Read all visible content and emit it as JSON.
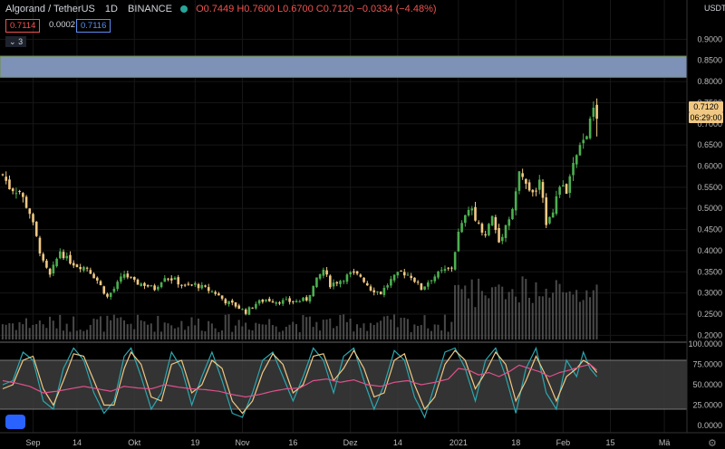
{
  "header": {
    "symbol": "Algorand / TetherUS",
    "interval": "1D",
    "exchange": "BINANCE",
    "ohlc": "O0.7449 H0.7600 L0.6700 C0.7120 −0.0334 (−4.48%)",
    "bid": "0.7114",
    "spread": "0.0002",
    "ask": "0.7116",
    "collapse_label": "3"
  },
  "price_axis": {
    "currency": "USDT",
    "current_price_label": "0.7120",
    "countdown_label": "06:29:00"
  },
  "colors": {
    "up": "#4caf50",
    "down": "#f0c883",
    "zone_fill": "#7e92b8",
    "k_line": "#2aa7b0",
    "d_line": "#f0c883",
    "rsi_line": "#e0508c",
    "band": "#3c3c3c"
  },
  "icons": [
    "chevron-down-icon",
    "tradingview-logo-icon",
    "settings-gear-icon"
  ],
  "chart_data": [
    {
      "type": "candlestick",
      "title": "Algorand / TetherUS 1D BINANCE",
      "ylim": [
        0.19,
        0.95
      ],
      "y_ticks": [
        0.2,
        0.25,
        0.3,
        0.35,
        0.4,
        0.45,
        0.5,
        0.55,
        0.6,
        0.65,
        0.7,
        0.75,
        0.8,
        0.85,
        0.9
      ],
      "x_tick_labels": [
        "Sep",
        "14",
        "Okt",
        "19",
        "Nov",
        "16",
        "Dez",
        "14",
        "2021",
        "18",
        "Feb",
        "15",
        "Mä"
      ],
      "x_tick_day_index": [
        9,
        22,
        39,
        57,
        71,
        86,
        103,
        117,
        135,
        152,
        166,
        180,
        196
      ],
      "resistance_zone": [
        0.81,
        0.86
      ],
      "price_anchors": [
        [
          0,
          0.58
        ],
        [
          2,
          0.55
        ],
        [
          5,
          0.54
        ],
        [
          8,
          0.49
        ],
        [
          12,
          0.37
        ],
        [
          14,
          0.34
        ],
        [
          17,
          0.4
        ],
        [
          19,
          0.38
        ],
        [
          22,
          0.365
        ],
        [
          25,
          0.36
        ],
        [
          28,
          0.33
        ],
        [
          31,
          0.29
        ],
        [
          33,
          0.31
        ],
        [
          36,
          0.345
        ],
        [
          39,
          0.325
        ],
        [
          42,
          0.32
        ],
        [
          45,
          0.31
        ],
        [
          48,
          0.34
        ],
        [
          51,
          0.33
        ],
        [
          54,
          0.315
        ],
        [
          57,
          0.32
        ],
        [
          60,
          0.31
        ],
        [
          63,
          0.3
        ],
        [
          66,
          0.28
        ],
        [
          69,
          0.27
        ],
        [
          72,
          0.255
        ],
        [
          75,
          0.275
        ],
        [
          78,
          0.285
        ],
        [
          81,
          0.28
        ],
        [
          84,
          0.28
        ],
        [
          87,
          0.28
        ],
        [
          90,
          0.285
        ],
        [
          93,
          0.33
        ],
        [
          95,
          0.355
        ],
        [
          97,
          0.32
        ],
        [
          100,
          0.33
        ],
        [
          103,
          0.345
        ],
        [
          106,
          0.34
        ],
        [
          109,
          0.31
        ],
        [
          112,
          0.3
        ],
        [
          115,
          0.33
        ],
        [
          118,
          0.35
        ],
        [
          121,
          0.34
        ],
        [
          124,
          0.31
        ],
        [
          127,
          0.335
        ],
        [
          130,
          0.35
        ],
        [
          133,
          0.36
        ],
        [
          135,
          0.44
        ],
        [
          137,
          0.48
        ],
        [
          139,
          0.5
        ],
        [
          141,
          0.46
        ],
        [
          143,
          0.44
        ],
        [
          145,
          0.48
        ],
        [
          147,
          0.42
        ],
        [
          149,
          0.46
        ],
        [
          151,
          0.5
        ],
        [
          153,
          0.58
        ],
        [
          155,
          0.56
        ],
        [
          157,
          0.53
        ],
        [
          159,
          0.56
        ],
        [
          161,
          0.47
        ],
        [
          163,
          0.5
        ],
        [
          165,
          0.55
        ],
        [
          167,
          0.54
        ],
        [
          169,
          0.6
        ],
        [
          171,
          0.64
        ],
        [
          172,
          0.66
        ],
        [
          174,
          0.7
        ],
        [
          175,
          0.7449
        ],
        [
          176,
          0.712
        ]
      ],
      "last_candle": {
        "open": 0.7449,
        "high": 0.76,
        "low": 0.67,
        "close": 0.712,
        "change": -0.0334,
        "change_pct": -4.48
      }
    },
    {
      "type": "line",
      "title": "",
      "ylim": [
        0,
        100
      ],
      "y_ticks": [
        0,
        25,
        50,
        75,
        100
      ],
      "y_tick_labels": [
        "0.0000",
        "25.0000",
        "50.0000",
        "75.0000",
        "100.0000"
      ],
      "band": [
        20,
        80
      ],
      "series": [
        {
          "key": "k",
          "anchors": [
            [
              0,
              50
            ],
            [
              3,
              55
            ],
            [
              6,
              90
            ],
            [
              9,
              80
            ],
            [
              12,
              30
            ],
            [
              15,
              20
            ],
            [
              18,
              70
            ],
            [
              21,
              95
            ],
            [
              24,
              80
            ],
            [
              27,
              40
            ],
            [
              30,
              15
            ],
            [
              33,
              30
            ],
            [
              36,
              85
            ],
            [
              38,
              95
            ],
            [
              41,
              60
            ],
            [
              44,
              20
            ],
            [
              47,
              40
            ],
            [
              50,
              90
            ],
            [
              53,
              70
            ],
            [
              56,
              25
            ],
            [
              59,
              60
            ],
            [
              62,
              90
            ],
            [
              65,
              55
            ],
            [
              68,
              15
            ],
            [
              71,
              10
            ],
            [
              74,
              40
            ],
            [
              77,
              80
            ],
            [
              80,
              90
            ],
            [
              83,
              60
            ],
            [
              86,
              30
            ],
            [
              89,
              60
            ],
            [
              92,
              95
            ],
            [
              95,
              80
            ],
            [
              98,
              40
            ],
            [
              101,
              85
            ],
            [
              104,
              95
            ],
            [
              107,
              55
            ],
            [
              110,
              20
            ],
            [
              113,
              50
            ],
            [
              116,
              92
            ],
            [
              119,
              80
            ],
            [
              122,
              35
            ],
            [
              125,
              10
            ],
            [
              128,
              50
            ],
            [
              131,
              90
            ],
            [
              134,
              95
            ],
            [
              137,
              70
            ],
            [
              140,
              30
            ],
            [
              143,
              80
            ],
            [
              146,
              95
            ],
            [
              149,
              60
            ],
            [
              152,
              15
            ],
            [
              155,
              70
            ],
            [
              158,
              95
            ],
            [
              161,
              40
            ],
            [
              164,
              20
            ],
            [
              167,
              80
            ],
            [
              170,
              60
            ],
            [
              172,
              90
            ],
            [
              174,
              70
            ],
            [
              176,
              60
            ]
          ]
        },
        {
          "key": "d",
          "anchors": [
            [
              0,
              45
            ],
            [
              3,
              50
            ],
            [
              6,
              80
            ],
            [
              9,
              85
            ],
            [
              12,
              45
            ],
            [
              15,
              25
            ],
            [
              18,
              55
            ],
            [
              21,
              88
            ],
            [
              24,
              85
            ],
            [
              27,
              55
            ],
            [
              30,
              25
            ],
            [
              33,
              25
            ],
            [
              36,
              70
            ],
            [
              38,
              90
            ],
            [
              41,
              75
            ],
            [
              44,
              35
            ],
            [
              47,
              30
            ],
            [
              50,
              75
            ],
            [
              53,
              80
            ],
            [
              56,
              40
            ],
            [
              59,
              50
            ],
            [
              62,
              80
            ],
            [
              65,
              70
            ],
            [
              68,
              30
            ],
            [
              71,
              15
            ],
            [
              74,
              30
            ],
            [
              77,
              65
            ],
            [
              80,
              88
            ],
            [
              83,
              75
            ],
            [
              86,
              40
            ],
            [
              89,
              50
            ],
            [
              92,
              85
            ],
            [
              95,
              88
            ],
            [
              98,
              55
            ],
            [
              101,
              70
            ],
            [
              104,
              92
            ],
            [
              107,
              70
            ],
            [
              110,
              35
            ],
            [
              113,
              40
            ],
            [
              116,
              80
            ],
            [
              119,
              88
            ],
            [
              122,
              50
            ],
            [
              125,
              20
            ],
            [
              128,
              35
            ],
            [
              131,
              75
            ],
            [
              134,
              92
            ],
            [
              137,
              80
            ],
            [
              140,
              45
            ],
            [
              143,
              65
            ],
            [
              146,
              90
            ],
            [
              149,
              75
            ],
            [
              152,
              30
            ],
            [
              155,
              55
            ],
            [
              158,
              85
            ],
            [
              161,
              60
            ],
            [
              164,
              30
            ],
            [
              167,
              60
            ],
            [
              170,
              70
            ],
            [
              172,
              80
            ],
            [
              174,
              75
            ],
            [
              176,
              65
            ]
          ]
        },
        {
          "key": "rsi",
          "anchors": [
            [
              0,
              55
            ],
            [
              4,
              52
            ],
            [
              8,
              48
            ],
            [
              12,
              40
            ],
            [
              16,
              42
            ],
            [
              20,
              45
            ],
            [
              24,
              48
            ],
            [
              28,
              45
            ],
            [
              32,
              42
            ],
            [
              36,
              48
            ],
            [
              40,
              46
            ],
            [
              44,
              45
            ],
            [
              48,
              50
            ],
            [
              52,
              47
            ],
            [
              56,
              45
            ],
            [
              60,
              44
            ],
            [
              64,
              42
            ],
            [
              68,
              38
            ],
            [
              72,
              35
            ],
            [
              76,
              38
            ],
            [
              80,
              42
            ],
            [
              84,
              45
            ],
            [
              88,
              46
            ],
            [
              92,
              55
            ],
            [
              96,
              57
            ],
            [
              100,
              53
            ],
            [
              104,
              56
            ],
            [
              108,
              50
            ],
            [
              112,
              48
            ],
            [
              116,
              53
            ],
            [
              120,
              55
            ],
            [
              124,
              50
            ],
            [
              128,
              53
            ],
            [
              132,
              57
            ],
            [
              135,
              70
            ],
            [
              138,
              68
            ],
            [
              141,
              62
            ],
            [
              144,
              65
            ],
            [
              147,
              60
            ],
            [
              150,
              66
            ],
            [
              153,
              74
            ],
            [
              156,
              70
            ],
            [
              159,
              66
            ],
            [
              162,
              60
            ],
            [
              165,
              65
            ],
            [
              168,
              68
            ],
            [
              171,
              72
            ],
            [
              174,
              75
            ],
            [
              176,
              68
            ]
          ]
        }
      ]
    }
  ]
}
